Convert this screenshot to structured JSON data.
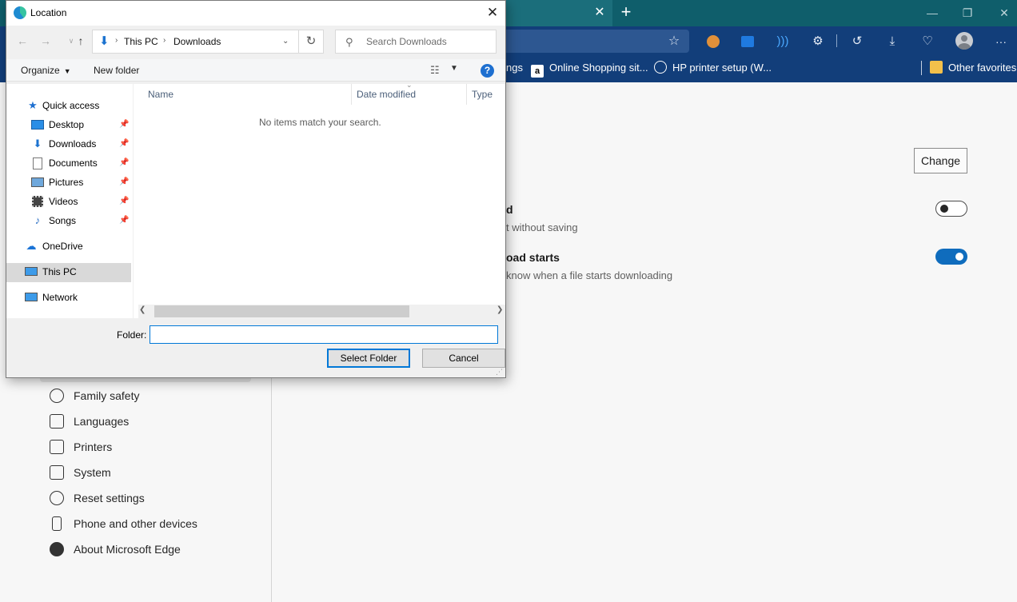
{
  "browser": {
    "tab_close": "✕",
    "new_tab": "+",
    "window_controls": {
      "minimize": "—",
      "restore": "❐",
      "close": "✕"
    },
    "favorites_bar": {
      "items": [
        {
          "label": "ngs",
          "icon": "page-icon"
        },
        {
          "label": "Online Shopping sit...",
          "icon": "amazon-icon"
        },
        {
          "label": "HP printer setup (W...",
          "icon": "hp-icon"
        }
      ],
      "other_favorites": "Other favorites"
    },
    "toolbar_icons": [
      "favorite-add-icon",
      "extension-icon",
      "outlook-icon",
      "read-aloud-icon",
      "extensions-icon",
      "history-icon",
      "downloads-icon",
      "browser-essentials-icon",
      "profile-icon",
      "more-icon"
    ]
  },
  "settings": {
    "nav_items": [
      {
        "label": "Family safety",
        "icon": "family-icon"
      },
      {
        "label": "Languages",
        "icon": "languages-icon"
      },
      {
        "label": "Printers",
        "icon": "printer-icon"
      },
      {
        "label": "System",
        "icon": "system-icon"
      },
      {
        "label": "Reset settings",
        "icon": "reset-icon"
      },
      {
        "label": "Phone and other devices",
        "icon": "phone-icon"
      },
      {
        "label": "About Microsoft Edge",
        "icon": "edge-icon"
      }
    ],
    "change_button": "Change",
    "rows": [
      {
        "title": "d",
        "desc": "t without saving",
        "toggle": false
      },
      {
        "title": "oad starts",
        "desc": "know when a file starts downloading",
        "toggle": true
      }
    ],
    "colors": {
      "accent": "#0f6cbd",
      "titlebar": "#0f5e6b",
      "toolbar": "#123e7a"
    }
  },
  "dialog": {
    "title": "Location",
    "close": "✕",
    "path": [
      "This PC",
      "Downloads"
    ],
    "search_placeholder": "Search Downloads",
    "commands": {
      "organize": "Organize",
      "new_folder": "New folder",
      "help": "?"
    },
    "tree": [
      {
        "label": "Quick access",
        "icon": "star-icon",
        "level": 0
      },
      {
        "label": "Desktop",
        "icon": "desktop-icon",
        "level": 1,
        "pinned": true
      },
      {
        "label": "Downloads",
        "icon": "download-arrow-icon",
        "level": 1,
        "pinned": true
      },
      {
        "label": "Documents",
        "icon": "document-icon",
        "level": 1,
        "pinned": true
      },
      {
        "label": "Pictures",
        "icon": "pictures-icon",
        "level": 1,
        "pinned": true
      },
      {
        "label": "Videos",
        "icon": "videos-icon",
        "level": 1,
        "pinned": true
      },
      {
        "label": "Songs",
        "icon": "music-icon",
        "level": 1,
        "pinned": true
      },
      {
        "label": "OneDrive",
        "icon": "cloud-icon",
        "level": 0
      },
      {
        "label": "This PC",
        "icon": "computer-icon",
        "level": 0,
        "selected": true
      },
      {
        "label": "Network",
        "icon": "network-icon",
        "level": 0
      }
    ],
    "columns": [
      "Name",
      "Date modified",
      "Type"
    ],
    "empty_message": "No items match your search.",
    "folder_label": "Folder:",
    "folder_value": "",
    "buttons": {
      "select": "Select Folder",
      "cancel": "Cancel"
    }
  }
}
